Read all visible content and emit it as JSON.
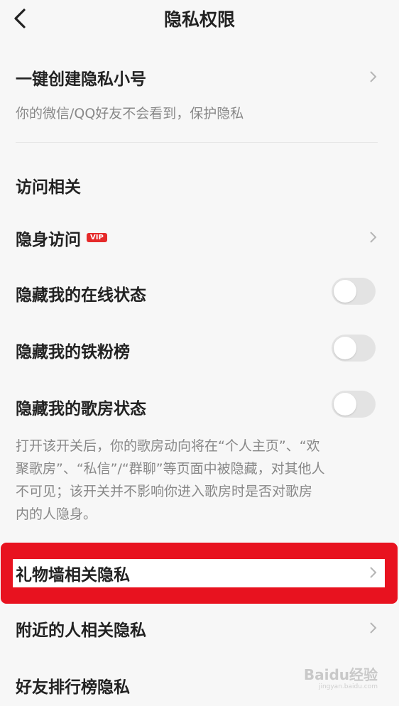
{
  "header": {
    "title": "隐私权限"
  },
  "create_account": {
    "label": "一键创建隐私小号",
    "description": "你的微信/QQ好友不会看到，保护隐私"
  },
  "section_visit": {
    "title": "访问相关"
  },
  "rows": {
    "invisible_visit": {
      "label": "隐身访问",
      "badge": "VIP"
    },
    "hide_online": {
      "label": "隐藏我的在线状态",
      "enabled": false
    },
    "hide_fans": {
      "label": "隐藏我的铁粉榜",
      "enabled": false
    },
    "hide_room": {
      "label": "隐藏我的歌房状态",
      "enabled": false
    },
    "room_desc": {
      "line1": "打开该开关后，你的歌房动向将在“个人主页”、“欢",
      "line2": "聚歌房”、“私信”/“群聊”等页面中被隐藏，对其他人",
      "line3": "不可见；该开关并不影响你进入歌房时是否对歌房",
      "line4": "内的人隐身。"
    },
    "gift_wall": {
      "label": "礼物墙相关隐私"
    },
    "nearby": {
      "label": "附近的人相关隐私"
    },
    "friend_rank": {
      "label": "好友排行榜隐私"
    }
  },
  "watermark": {
    "text": "Baidu经验",
    "sub": "jingyan.baidu.com"
  },
  "colors": {
    "highlight": "#e8121f",
    "vip": "#e52a2a",
    "toggle_off": "#e3e3e3"
  }
}
